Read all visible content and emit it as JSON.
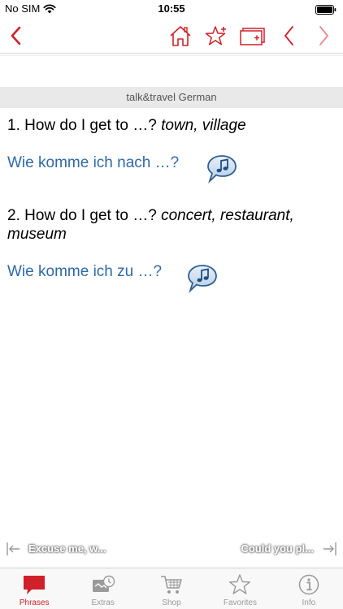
{
  "status": {
    "carrier": "No SIM",
    "time": "10:55"
  },
  "header": {
    "section": "talk&travel German"
  },
  "phrases": [
    {
      "number": "1.",
      "text": "How do I get to …?",
      "hint": "town, village",
      "translation": "Wie komme ich nach …?"
    },
    {
      "number": "2.",
      "text": "How do I get to …?",
      "hint": "concert, restaurant, museum",
      "translation": "Wie komme ich zu …?"
    }
  ],
  "browse": {
    "prev": "Excuse me, w...",
    "next": "Could you pl..."
  },
  "tabs": [
    {
      "label": "Phrases",
      "icon": "speech-bubble-icon"
    },
    {
      "label": "Extras",
      "icon": "extras-icon"
    },
    {
      "label": "Shop",
      "icon": "cart-icon"
    },
    {
      "label": "Favorites",
      "icon": "star-icon"
    },
    {
      "label": "Info",
      "icon": "info-icon"
    }
  ],
  "colors": {
    "accent": "#d0202a",
    "translation": "#2f6aa8",
    "header_bg": "#e9e9e9"
  }
}
